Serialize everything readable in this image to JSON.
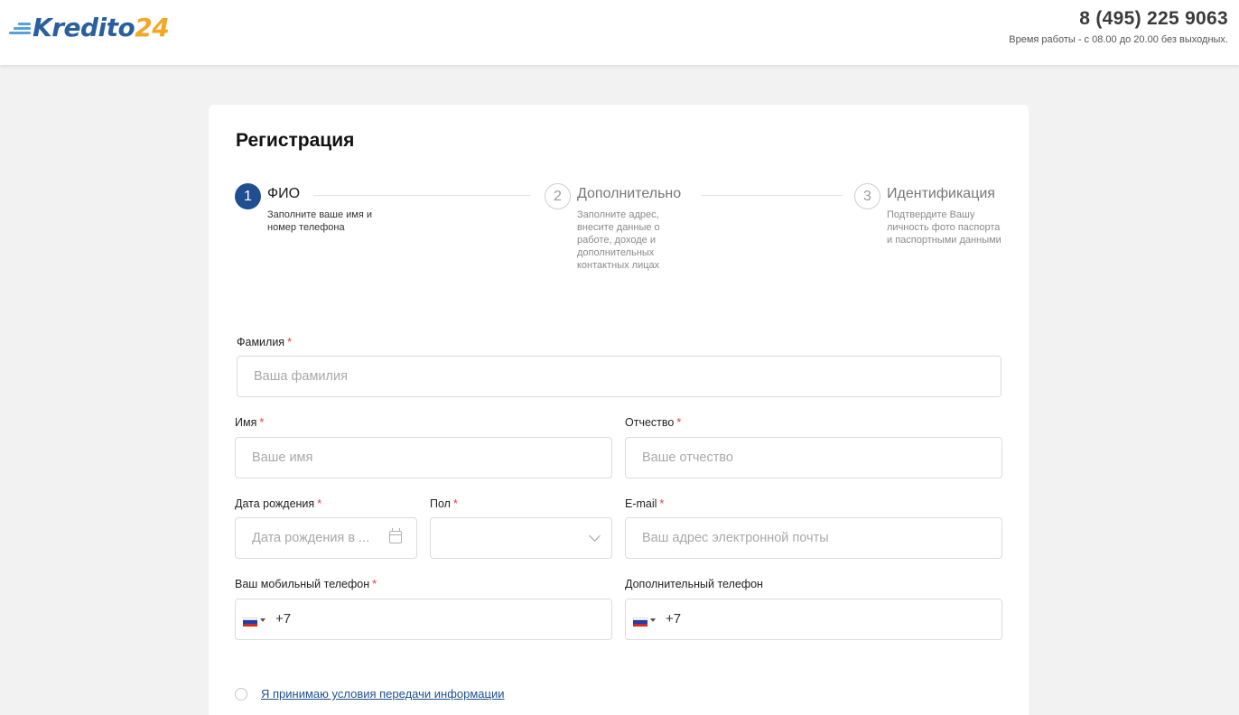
{
  "header": {
    "logo_text_main": "Kredito",
    "logo_text_num": "24",
    "phone": "8 (495) 225 9063",
    "hours": "Время работы - с 08.00 до 20.00 без выходных."
  },
  "page": {
    "title": "Регистрация"
  },
  "steps": [
    {
      "number": "1",
      "title": "ФИО",
      "description": "Заполните ваше имя и номер телефона",
      "state": "active"
    },
    {
      "number": "2",
      "title": "Дополнительно",
      "description": "Заполните адрес, внесите данные о работе, доходе и дополнительных контактных лицах",
      "state": "inactive"
    },
    {
      "number": "3",
      "title": "Идентификация",
      "description": "Подтвердите Вашу личность фото паспорта и паспортными данными",
      "state": "inactive"
    }
  ],
  "form": {
    "surname": {
      "label": "Фамилия",
      "required": "*",
      "placeholder": "Ваша фамилия"
    },
    "name": {
      "label": "Имя",
      "required": "*",
      "placeholder": "Ваше имя"
    },
    "patronymic": {
      "label": "Отчество",
      "required": "*",
      "placeholder": "Ваше отчество"
    },
    "birthdate": {
      "label": "Дата рождения",
      "required": "*",
      "placeholder": "Дата рождения в ..."
    },
    "gender": {
      "label": "Пол",
      "required": "*",
      "value": ""
    },
    "email": {
      "label": "E-mail",
      "required": "*",
      "placeholder": "Ваш адрес электронной почты"
    },
    "mobile": {
      "label": "Ваш мобильный телефон",
      "required": "*",
      "value": "+7"
    },
    "extra_phone": {
      "label": "Дополнительный телефон",
      "value": "+7"
    },
    "agreement": {
      "label": "Я принимаю условия передачи информации"
    }
  },
  "colors": {
    "accent": "#1f4f91",
    "logo_blue": "#2a5f9e",
    "logo_orange": "#f5a623",
    "required": "#e23a3a",
    "background": "#f2f2f2"
  },
  "icons": {
    "logo": "speed-lines-icon",
    "calendar": "calendar-icon",
    "select": "chevron-down-icon",
    "flag": "russia-flag-icon"
  }
}
